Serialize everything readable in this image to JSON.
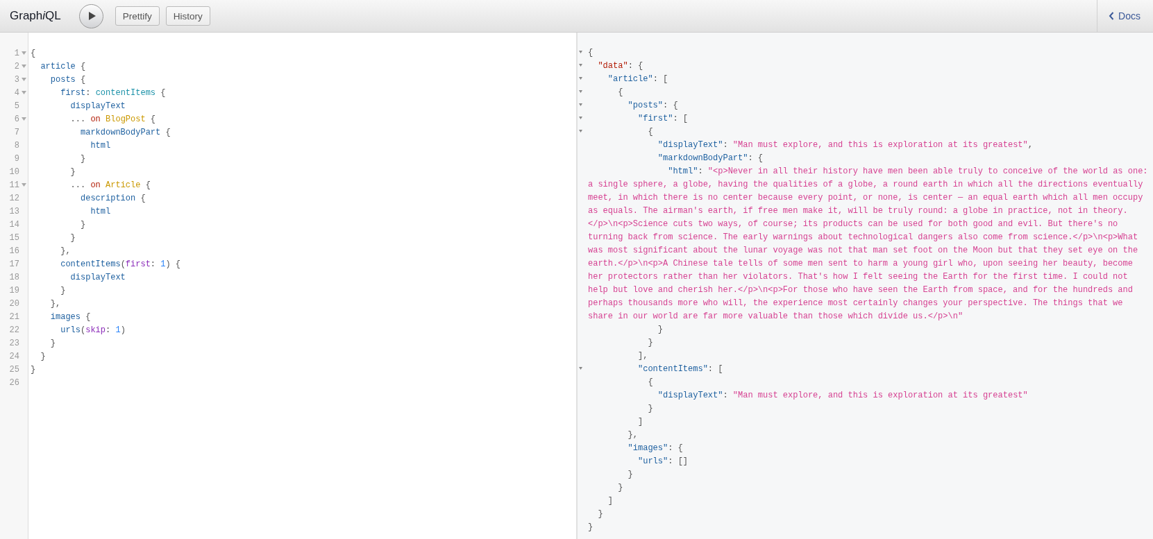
{
  "toolbar": {
    "title": [
      {
        "text": "Graph",
        "italic": false
      },
      {
        "text": "i",
        "italic": true
      },
      {
        "text": "QL",
        "italic": false
      }
    ],
    "buttons": [
      {
        "kind": "execute"
      },
      {
        "kind": "text",
        "label": "Prettify"
      },
      {
        "kind": "text",
        "label": "History"
      }
    ],
    "docs_link": "Docs"
  },
  "query_editor": {
    "lines": [
      {
        "number": "1",
        "foldable": true,
        "tokens": [
          {
            "kind": "punct",
            "text": "{"
          }
        ]
      },
      {
        "number": "2",
        "foldable": true,
        "tokens": [
          {
            "kind": "field",
            "text": "  article"
          },
          {
            "kind": "punct",
            "text": " {"
          }
        ]
      },
      {
        "number": "3",
        "foldable": true,
        "tokens": [
          {
            "kind": "field",
            "text": "    posts"
          },
          {
            "kind": "punct",
            "text": " {"
          }
        ]
      },
      {
        "number": "4",
        "foldable": true,
        "tokens": [
          {
            "kind": "field",
            "text": "      first"
          },
          {
            "kind": "punct",
            "text": ": "
          },
          {
            "kind": "alias",
            "text": "contentItems"
          },
          {
            "kind": "punct",
            "text": " {"
          }
        ]
      },
      {
        "number": "5",
        "foldable": false,
        "tokens": [
          {
            "kind": "field",
            "text": "        displayText"
          }
        ]
      },
      {
        "number": "6",
        "foldable": true,
        "tokens": [
          {
            "kind": "punct",
            "text": "        ... "
          },
          {
            "kind": "keyword",
            "text": "on"
          },
          {
            "kind": "type",
            "text": " BlogPost"
          },
          {
            "kind": "punct",
            "text": " {"
          }
        ]
      },
      {
        "number": "7",
        "foldable": false,
        "tokens": [
          {
            "kind": "field",
            "text": "          markdownBodyPart"
          },
          {
            "kind": "punct",
            "text": " {"
          }
        ]
      },
      {
        "number": "8",
        "foldable": false,
        "tokens": [
          {
            "kind": "field",
            "text": "            html"
          }
        ]
      },
      {
        "number": "9",
        "foldable": false,
        "tokens": [
          {
            "kind": "punct",
            "text": "          }"
          }
        ]
      },
      {
        "number": "10",
        "foldable": false,
        "tokens": [
          {
            "kind": "punct",
            "text": "        }"
          }
        ]
      },
      {
        "number": "11",
        "foldable": true,
        "tokens": [
          {
            "kind": "punct",
            "text": "        ... "
          },
          {
            "kind": "keyword",
            "text": "on"
          },
          {
            "kind": "type",
            "text": " Article"
          },
          {
            "kind": "punct",
            "text": " {"
          }
        ]
      },
      {
        "number": "12",
        "foldable": false,
        "tokens": [
          {
            "kind": "field",
            "text": "          description"
          },
          {
            "kind": "punct",
            "text": " {"
          }
        ]
      },
      {
        "number": "13",
        "foldable": false,
        "tokens": [
          {
            "kind": "field",
            "text": "            html"
          }
        ]
      },
      {
        "number": "14",
        "foldable": false,
        "tokens": [
          {
            "kind": "punct",
            "text": "          }"
          }
        ]
      },
      {
        "number": "15",
        "foldable": false,
        "tokens": [
          {
            "kind": "punct",
            "text": "        }"
          }
        ]
      },
      {
        "number": "16",
        "foldable": false,
        "tokens": [
          {
            "kind": "punct",
            "text": "      },"
          }
        ]
      },
      {
        "number": "17",
        "foldable": false,
        "tokens": [
          {
            "kind": "field",
            "text": "      contentItems"
          },
          {
            "kind": "punct",
            "text": "("
          },
          {
            "kind": "arg",
            "text": "first"
          },
          {
            "kind": "punct",
            "text": ": "
          },
          {
            "kind": "number",
            "text": "1"
          },
          {
            "kind": "punct",
            "text": ") {"
          }
        ]
      },
      {
        "number": "18",
        "foldable": false,
        "tokens": [
          {
            "kind": "field",
            "text": "        displayText"
          }
        ]
      },
      {
        "number": "19",
        "foldable": false,
        "tokens": [
          {
            "kind": "punct",
            "text": "      }"
          }
        ]
      },
      {
        "number": "20",
        "foldable": false,
        "tokens": [
          {
            "kind": "punct",
            "text": "    },"
          }
        ]
      },
      {
        "number": "21",
        "foldable": false,
        "tokens": [
          {
            "kind": "field",
            "text": "    images"
          },
          {
            "kind": "punct",
            "text": " {"
          }
        ]
      },
      {
        "number": "22",
        "foldable": false,
        "tokens": [
          {
            "kind": "field",
            "text": "      urls"
          },
          {
            "kind": "punct",
            "text": "("
          },
          {
            "kind": "arg",
            "text": "skip"
          },
          {
            "kind": "punct",
            "text": ": "
          },
          {
            "kind": "number",
            "text": "1"
          },
          {
            "kind": "punct",
            "text": ")"
          }
        ]
      },
      {
        "number": "23",
        "foldable": false,
        "tokens": [
          {
            "kind": "punct",
            "text": "    }"
          }
        ]
      },
      {
        "number": "24",
        "foldable": false,
        "tokens": [
          {
            "kind": "punct",
            "text": "  }"
          }
        ]
      },
      {
        "number": "25",
        "foldable": false,
        "tokens": [
          {
            "kind": "punct",
            "text": "}"
          }
        ]
      },
      {
        "number": "26",
        "foldable": false
      }
    ]
  },
  "result_viewer": {
    "lines": [
      {
        "foldable": true,
        "tokens": [
          {
            "kind": "punct",
            "text": "{"
          }
        ]
      },
      {
        "foldable": true,
        "tokens": [
          {
            "kind": "datakey",
            "text": "  \"data\""
          },
          {
            "kind": "punct",
            "text": ": {"
          }
        ]
      },
      {
        "foldable": true,
        "tokens": [
          {
            "kind": "key",
            "text": "    \"article\""
          },
          {
            "kind": "punct",
            "text": ": ["
          }
        ]
      },
      {
        "foldable": true,
        "tokens": [
          {
            "kind": "punct",
            "text": "      {"
          }
        ]
      },
      {
        "foldable": true,
        "tokens": [
          {
            "kind": "key",
            "text": "        \"posts\""
          },
          {
            "kind": "punct",
            "text": ": {"
          }
        ]
      },
      {
        "foldable": true,
        "tokens": [
          {
            "kind": "key",
            "text": "          \"first\""
          },
          {
            "kind": "punct",
            "text": ": ["
          }
        ]
      },
      {
        "foldable": true,
        "tokens": [
          {
            "kind": "punct",
            "text": "            {"
          }
        ]
      },
      {
        "foldable": false,
        "tokens": [
          {
            "kind": "key",
            "text": "              \"displayText\""
          },
          {
            "kind": "punct",
            "text": ": "
          },
          {
            "kind": "string",
            "text": "\"Man must explore, and this is exploration at its greatest\""
          },
          {
            "kind": "punct",
            "text": ","
          }
        ]
      },
      {
        "foldable": false,
        "tokens": [
          {
            "kind": "key",
            "text": "              \"markdownBodyPart\""
          },
          {
            "kind": "punct",
            "text": ": {"
          }
        ]
      },
      {
        "foldable": false,
        "tokens": [
          {
            "kind": "key",
            "text": "                \"html\""
          },
          {
            "kind": "punct",
            "text": ": "
          },
          {
            "kind": "string",
            "text": "\"<p>Never in all their history have men been able truly to conceive of the world as one: a single sphere, a globe, having the qualities of a globe, a round earth in which all the directions eventually meet, in which there is no center because every point, or none, is center — an equal earth which all men occupy as equals. The airman's earth, if free men make it, will be truly round: a globe in practice, not in theory.</p>\\n<p>Science cuts two ways, of course; its products can be used for both good and evil. But there's no turning back from science. The early warnings about technological dangers also come from science.</p>\\n<p>What was most significant about the lunar voyage was not that man set foot on the Moon but that they set eye on the earth.</p>\\n<p>A Chinese tale tells of some men sent to harm a young girl who, upon seeing her beauty, become her protectors rather than her violators. That's how I felt seeing the Earth for the first time. I could not help but love and cherish her.</p>\\n<p>For those who have seen the Earth from space, and for the hundreds and perhaps thousands more who will, the experience most certainly changes your perspective. The things that we share in our world are far more valuable than those which divide us.</p>\\n\""
          }
        ]
      },
      {
        "foldable": false,
        "tokens": [
          {
            "kind": "punct",
            "text": "              }"
          }
        ]
      },
      {
        "foldable": false,
        "tokens": [
          {
            "kind": "punct",
            "text": "            }"
          }
        ]
      },
      {
        "foldable": false,
        "tokens": [
          {
            "kind": "punct",
            "text": "          ],"
          }
        ]
      },
      {
        "foldable": true,
        "tokens": [
          {
            "kind": "key",
            "text": "          \"contentItems\""
          },
          {
            "kind": "punct",
            "text": ": ["
          }
        ]
      },
      {
        "foldable": false,
        "tokens": [
          {
            "kind": "punct",
            "text": "            {"
          }
        ]
      },
      {
        "foldable": false,
        "tokens": [
          {
            "kind": "key",
            "text": "              \"displayText\""
          },
          {
            "kind": "punct",
            "text": ": "
          },
          {
            "kind": "string",
            "text": "\"Man must explore, and this is exploration at its greatest\""
          }
        ]
      },
      {
        "foldable": false,
        "tokens": [
          {
            "kind": "punct",
            "text": "            }"
          }
        ]
      },
      {
        "foldable": false,
        "tokens": [
          {
            "kind": "punct",
            "text": "          ]"
          }
        ]
      },
      {
        "foldable": false,
        "tokens": [
          {
            "kind": "punct",
            "text": "        },"
          }
        ]
      },
      {
        "foldable": false,
        "tokens": [
          {
            "kind": "key",
            "text": "        \"images\""
          },
          {
            "kind": "punct",
            "text": ": {"
          }
        ]
      },
      {
        "foldable": false,
        "tokens": [
          {
            "kind": "key",
            "text": "          \"urls\""
          },
          {
            "kind": "punct",
            "text": ": []"
          }
        ]
      },
      {
        "foldable": false,
        "tokens": [
          {
            "kind": "punct",
            "text": "        }"
          }
        ]
      },
      {
        "foldable": false,
        "tokens": [
          {
            "kind": "punct",
            "text": "      }"
          }
        ]
      },
      {
        "foldable": false,
        "tokens": [
          {
            "kind": "punct",
            "text": "    ]"
          }
        ]
      },
      {
        "foldable": false,
        "tokens": [
          {
            "kind": "punct",
            "text": "  }"
          }
        ]
      },
      {
        "foldable": false,
        "tokens": [
          {
            "kind": "punct",
            "text": "}"
          }
        ]
      }
    ]
  }
}
